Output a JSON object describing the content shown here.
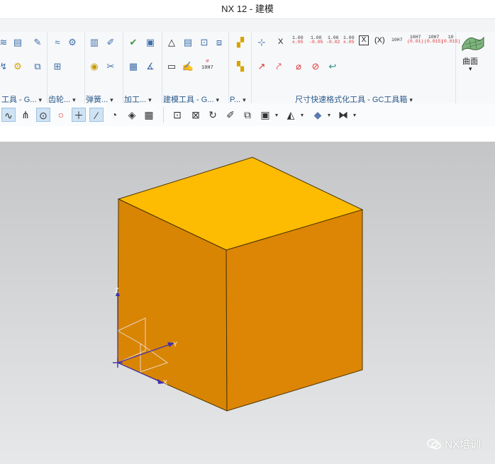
{
  "window": {
    "title": "NX 12 - 建模"
  },
  "ribbon": {
    "groups": [
      {
        "label": "工具 - G...",
        "dropdown": "▾"
      },
      {
        "label": "齿轮...",
        "dropdown": "▾"
      },
      {
        "label": "弹簧...",
        "dropdown": "▾"
      },
      {
        "label": "加工...",
        "dropdown": "▾"
      },
      {
        "label": "建模工具 - G...",
        "dropdown": "▾"
      },
      {
        "label": "P...",
        "dropdown": "▾"
      },
      {
        "label": "尺寸快速格式化工具 - GC工具箱",
        "dropdown": "▾"
      }
    ],
    "dimension_icons": [
      {
        "top": "1.00",
        "bottom": "±.05"
      },
      {
        "top": "1.00",
        "bottom": "-0.05"
      },
      {
        "top": "1.00",
        "bottom": "-0.02"
      },
      {
        "top": "1.00",
        "bottom": "±.05"
      },
      {
        "top": "10H7",
        "bottom": ""
      },
      {
        "top": "10H7",
        "bottom": "(0.01)"
      },
      {
        "top": "10H7",
        "bottom": "(0.015)"
      },
      {
        "top": "10",
        "bottom": "(0.015)"
      }
    ],
    "fit_label": "10H7",
    "surface_label": "曲面",
    "surface_dropdown": "▾"
  },
  "toolbar": {
    "dropdown": "▾"
  },
  "viewport": {
    "axis_labels": {
      "z": "Z",
      "y": "Y",
      "x": "X"
    },
    "cube_colors": {
      "top": "#fdbb02",
      "left": "#d98504",
      "right": "#dd8504",
      "edge": "#4a3300"
    }
  },
  "watermark": {
    "text": "NX培训"
  }
}
